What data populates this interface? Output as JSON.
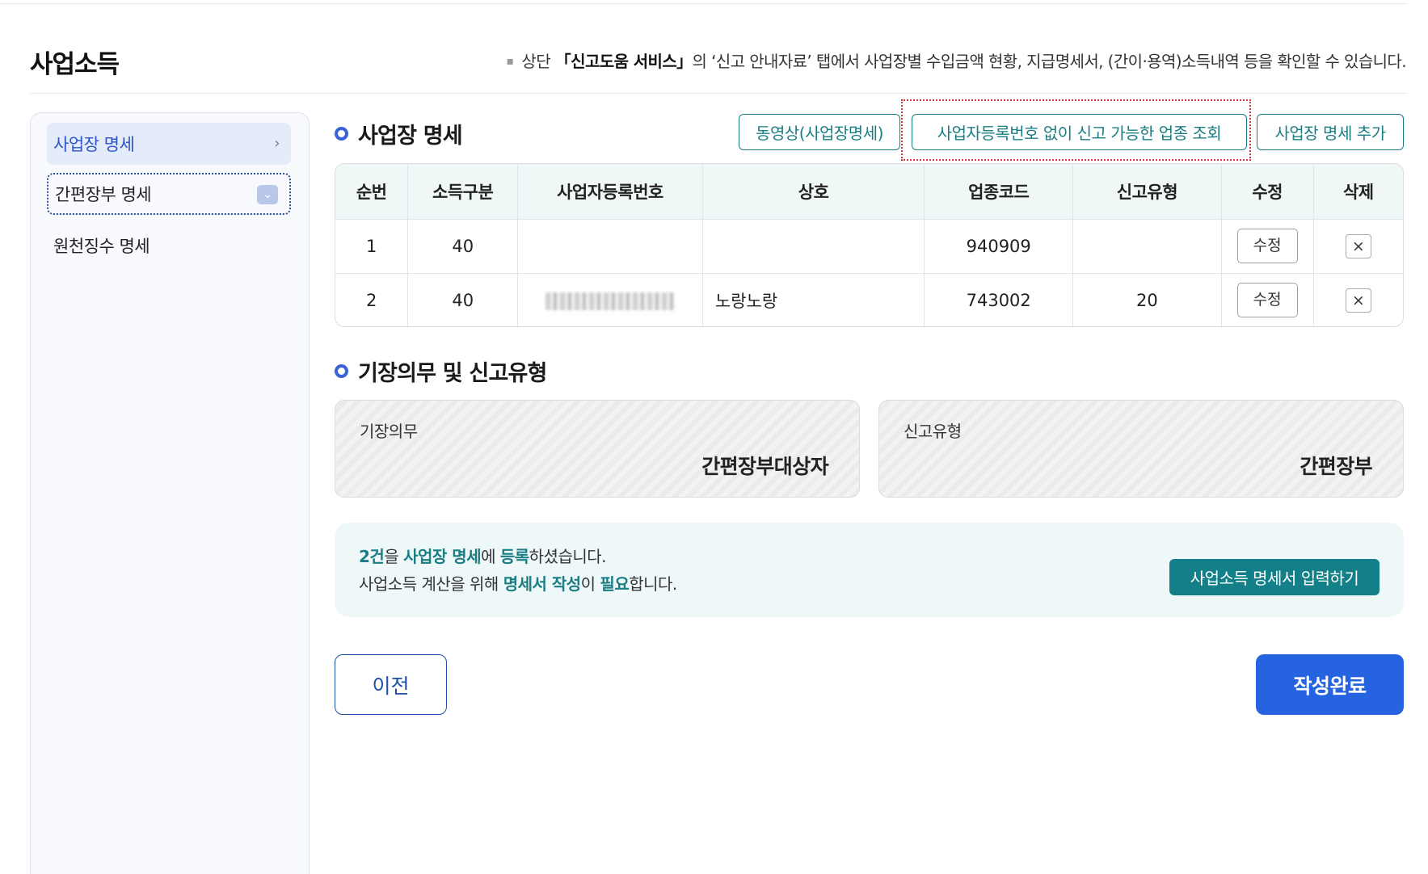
{
  "header": {
    "title": "사업소득",
    "note_prefix": "상단 ",
    "note_bold": "「신고도움 서비스」",
    "note_suffix": "의 ‘신고 안내자료’ 탭에서 사업장별 수입금액 현황, 지급명세서, (간이·용역)소득내역 등을 확인할 수 있습니다."
  },
  "sidebar": {
    "items": [
      {
        "label": "사업장 명세",
        "state": "active"
      },
      {
        "label": "간편장부 명세",
        "state": "focused"
      },
      {
        "label": "원천징수 명세",
        "state": "normal"
      }
    ]
  },
  "business": {
    "title": "사업장 명세",
    "buttons": {
      "video": "동영상(사업장명세)",
      "lookup": "사업자등록번호 없이 신고 가능한 업종 조회",
      "add": "사업장 명세 추가"
    },
    "columns": [
      "순번",
      "소득구분",
      "사업자등록번호",
      "상호",
      "업종코드",
      "신고유형",
      "수정",
      "삭제"
    ],
    "rows": [
      {
        "no": "1",
        "income_type": "40",
        "biz_no": "",
        "name": "",
        "code": "940909",
        "report_type": "",
        "edit": "수정"
      },
      {
        "no": "2",
        "income_type": "40",
        "biz_no": "",
        "name": "노랑노랑",
        "code": "743002",
        "report_type": "20",
        "edit": "수정"
      }
    ],
    "delete_symbol": "×"
  },
  "bookkeeping": {
    "title": "기장의무 및 신고유형",
    "duty_label": "기장의무",
    "duty_value": "간편장부대상자",
    "type_label": "신고유형",
    "type_value": "간편장부"
  },
  "notice": {
    "l1_a": "2건",
    "l1_b": "을 ",
    "l1_c": "사업장 명세",
    "l1_d": "에 ",
    "l1_e": "등록",
    "l1_f": "하셨습니다.",
    "l2_a": "사업소득 계산을 위해 ",
    "l2_b": "명세서 작성",
    "l2_c": "이 ",
    "l2_d": "필요",
    "l2_e": "합니다.",
    "cta": "사업소득 명세서 입력하기"
  },
  "footer": {
    "prev": "이전",
    "done": "작성완료"
  },
  "colors": {
    "teal": "#1b7d84",
    "blue": "#2563e0",
    "active_bg": "#e4ebfb",
    "focus_frame": "#d23a3a"
  }
}
